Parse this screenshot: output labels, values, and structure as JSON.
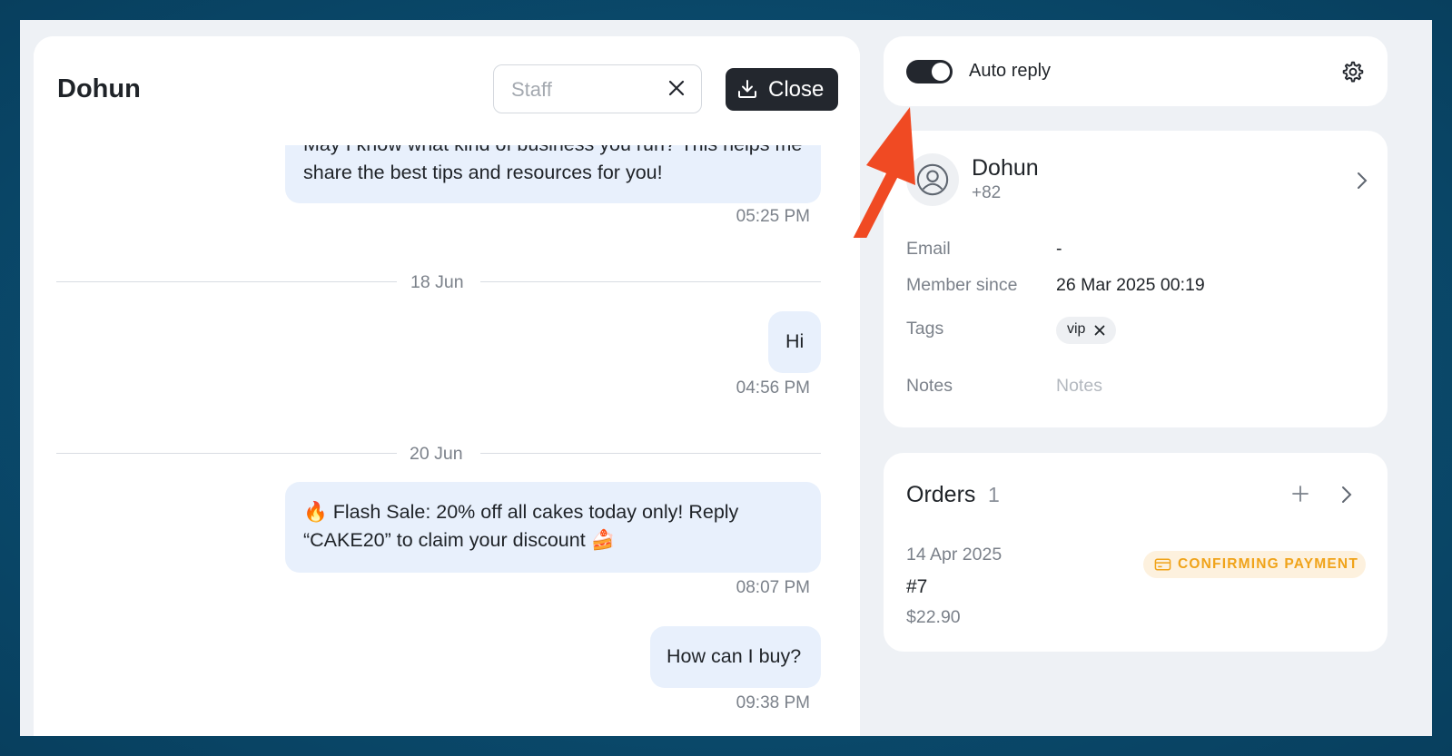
{
  "chat": {
    "title": "Dohun",
    "staff_placeholder": "Staff",
    "close_label": "Close",
    "messages": [
      {
        "text": "May I know what kind of business you run? This helps me share the best tips and resources for you!",
        "time": "05:25 PM"
      },
      {
        "text": "Hi",
        "time": "04:56 PM"
      },
      {
        "text": "🔥 Flash Sale: 20% off all cakes today only! Reply “CAKE20” to claim your discount 🍰",
        "time": "08:07 PM"
      },
      {
        "text": "How can I buy?",
        "time": "09:38 PM"
      }
    ],
    "dividers": [
      "18 Jun",
      "20 Jun"
    ]
  },
  "auto_reply": {
    "label": "Auto reply",
    "enabled": true
  },
  "contact": {
    "name": "Dohun",
    "phone": "+82",
    "email_label": "Email",
    "email_value": "-",
    "member_since_label": "Member since",
    "member_since_value": "26 Mar 2025 00:19",
    "tags_label": "Tags",
    "tags": [
      "vip"
    ],
    "notes_label": "Notes",
    "notes_placeholder": "Notes"
  },
  "orders": {
    "title": "Orders",
    "count": "1",
    "items": [
      {
        "date": "14 Apr 2025",
        "number": "#7",
        "amount": "$22.90",
        "status": "CONFIRMING PAYMENT"
      }
    ]
  },
  "colors": {
    "accent_dark": "#23272e",
    "bubble": "#e8f0fc",
    "annotation_arrow": "#f04a23",
    "status_text": "#f0a31a",
    "status_bg": "#fdf1de"
  }
}
